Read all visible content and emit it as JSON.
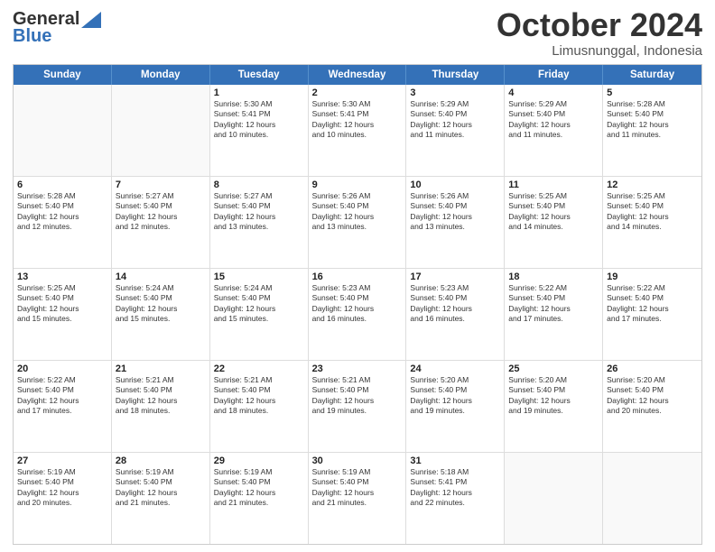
{
  "logo": {
    "general": "General",
    "blue": "Blue"
  },
  "header": {
    "month": "October 2024",
    "location": "Limusnunggal, Indonesia"
  },
  "days": [
    "Sunday",
    "Monday",
    "Tuesday",
    "Wednesday",
    "Thursday",
    "Friday",
    "Saturday"
  ],
  "rows": [
    [
      {
        "day": "",
        "lines": []
      },
      {
        "day": "",
        "lines": []
      },
      {
        "day": "1",
        "lines": [
          "Sunrise: 5:30 AM",
          "Sunset: 5:41 PM",
          "Daylight: 12 hours",
          "and 10 minutes."
        ]
      },
      {
        "day": "2",
        "lines": [
          "Sunrise: 5:30 AM",
          "Sunset: 5:41 PM",
          "Daylight: 12 hours",
          "and 10 minutes."
        ]
      },
      {
        "day": "3",
        "lines": [
          "Sunrise: 5:29 AM",
          "Sunset: 5:40 PM",
          "Daylight: 12 hours",
          "and 11 minutes."
        ]
      },
      {
        "day": "4",
        "lines": [
          "Sunrise: 5:29 AM",
          "Sunset: 5:40 PM",
          "Daylight: 12 hours",
          "and 11 minutes."
        ]
      },
      {
        "day": "5",
        "lines": [
          "Sunrise: 5:28 AM",
          "Sunset: 5:40 PM",
          "Daylight: 12 hours",
          "and 11 minutes."
        ]
      }
    ],
    [
      {
        "day": "6",
        "lines": [
          "Sunrise: 5:28 AM",
          "Sunset: 5:40 PM",
          "Daylight: 12 hours",
          "and 12 minutes."
        ]
      },
      {
        "day": "7",
        "lines": [
          "Sunrise: 5:27 AM",
          "Sunset: 5:40 PM",
          "Daylight: 12 hours",
          "and 12 minutes."
        ]
      },
      {
        "day": "8",
        "lines": [
          "Sunrise: 5:27 AM",
          "Sunset: 5:40 PM",
          "Daylight: 12 hours",
          "and 13 minutes."
        ]
      },
      {
        "day": "9",
        "lines": [
          "Sunrise: 5:26 AM",
          "Sunset: 5:40 PM",
          "Daylight: 12 hours",
          "and 13 minutes."
        ]
      },
      {
        "day": "10",
        "lines": [
          "Sunrise: 5:26 AM",
          "Sunset: 5:40 PM",
          "Daylight: 12 hours",
          "and 13 minutes."
        ]
      },
      {
        "day": "11",
        "lines": [
          "Sunrise: 5:25 AM",
          "Sunset: 5:40 PM",
          "Daylight: 12 hours",
          "and 14 minutes."
        ]
      },
      {
        "day": "12",
        "lines": [
          "Sunrise: 5:25 AM",
          "Sunset: 5:40 PM",
          "Daylight: 12 hours",
          "and 14 minutes."
        ]
      }
    ],
    [
      {
        "day": "13",
        "lines": [
          "Sunrise: 5:25 AM",
          "Sunset: 5:40 PM",
          "Daylight: 12 hours",
          "and 15 minutes."
        ]
      },
      {
        "day": "14",
        "lines": [
          "Sunrise: 5:24 AM",
          "Sunset: 5:40 PM",
          "Daylight: 12 hours",
          "and 15 minutes."
        ]
      },
      {
        "day": "15",
        "lines": [
          "Sunrise: 5:24 AM",
          "Sunset: 5:40 PM",
          "Daylight: 12 hours",
          "and 15 minutes."
        ]
      },
      {
        "day": "16",
        "lines": [
          "Sunrise: 5:23 AM",
          "Sunset: 5:40 PM",
          "Daylight: 12 hours",
          "and 16 minutes."
        ]
      },
      {
        "day": "17",
        "lines": [
          "Sunrise: 5:23 AM",
          "Sunset: 5:40 PM",
          "Daylight: 12 hours",
          "and 16 minutes."
        ]
      },
      {
        "day": "18",
        "lines": [
          "Sunrise: 5:22 AM",
          "Sunset: 5:40 PM",
          "Daylight: 12 hours",
          "and 17 minutes."
        ]
      },
      {
        "day": "19",
        "lines": [
          "Sunrise: 5:22 AM",
          "Sunset: 5:40 PM",
          "Daylight: 12 hours",
          "and 17 minutes."
        ]
      }
    ],
    [
      {
        "day": "20",
        "lines": [
          "Sunrise: 5:22 AM",
          "Sunset: 5:40 PM",
          "Daylight: 12 hours",
          "and 17 minutes."
        ]
      },
      {
        "day": "21",
        "lines": [
          "Sunrise: 5:21 AM",
          "Sunset: 5:40 PM",
          "Daylight: 12 hours",
          "and 18 minutes."
        ]
      },
      {
        "day": "22",
        "lines": [
          "Sunrise: 5:21 AM",
          "Sunset: 5:40 PM",
          "Daylight: 12 hours",
          "and 18 minutes."
        ]
      },
      {
        "day": "23",
        "lines": [
          "Sunrise: 5:21 AM",
          "Sunset: 5:40 PM",
          "Daylight: 12 hours",
          "and 19 minutes."
        ]
      },
      {
        "day": "24",
        "lines": [
          "Sunrise: 5:20 AM",
          "Sunset: 5:40 PM",
          "Daylight: 12 hours",
          "and 19 minutes."
        ]
      },
      {
        "day": "25",
        "lines": [
          "Sunrise: 5:20 AM",
          "Sunset: 5:40 PM",
          "Daylight: 12 hours",
          "and 19 minutes."
        ]
      },
      {
        "day": "26",
        "lines": [
          "Sunrise: 5:20 AM",
          "Sunset: 5:40 PM",
          "Daylight: 12 hours",
          "and 20 minutes."
        ]
      }
    ],
    [
      {
        "day": "27",
        "lines": [
          "Sunrise: 5:19 AM",
          "Sunset: 5:40 PM",
          "Daylight: 12 hours",
          "and 20 minutes."
        ]
      },
      {
        "day": "28",
        "lines": [
          "Sunrise: 5:19 AM",
          "Sunset: 5:40 PM",
          "Daylight: 12 hours",
          "and 21 minutes."
        ]
      },
      {
        "day": "29",
        "lines": [
          "Sunrise: 5:19 AM",
          "Sunset: 5:40 PM",
          "Daylight: 12 hours",
          "and 21 minutes."
        ]
      },
      {
        "day": "30",
        "lines": [
          "Sunrise: 5:19 AM",
          "Sunset: 5:40 PM",
          "Daylight: 12 hours",
          "and 21 minutes."
        ]
      },
      {
        "day": "31",
        "lines": [
          "Sunrise: 5:18 AM",
          "Sunset: 5:41 PM",
          "Daylight: 12 hours",
          "and 22 minutes."
        ]
      },
      {
        "day": "",
        "lines": []
      },
      {
        "day": "",
        "lines": []
      }
    ]
  ]
}
